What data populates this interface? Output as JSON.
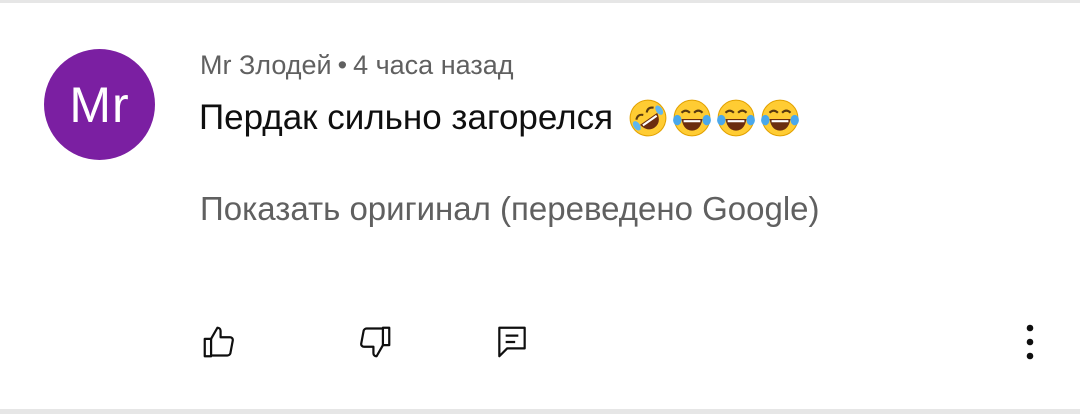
{
  "comment": {
    "avatar_initials": "Mr",
    "author": "Mr Злодей",
    "separator": "•",
    "time": "4 часа назад",
    "text": "Пердак сильно загорелся",
    "emojis": [
      "rolling-on-floor-laughing",
      "face-with-tears-of-joy",
      "face-with-tears-of-joy",
      "face-with-tears-of-joy"
    ],
    "translation_link": "Показать оригинал (переведено Google)"
  },
  "actions": {
    "like_icon": "thumbs-up-icon",
    "dislike_icon": "thumbs-down-icon",
    "reply_icon": "comment-icon",
    "menu_icon": "more-vertical-icon"
  },
  "colors": {
    "avatar_bg": "#7b1fa2",
    "meta_text": "#606060",
    "comment_text": "#0f0f0f"
  }
}
